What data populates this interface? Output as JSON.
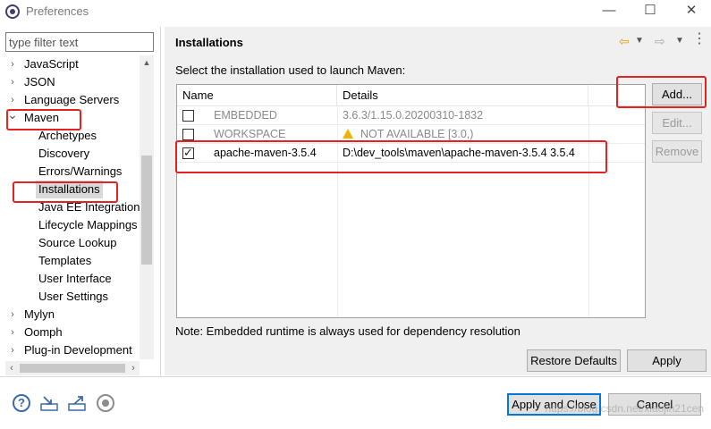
{
  "window": {
    "title": "Preferences",
    "minimize_glyph": "—",
    "maximize_glyph": "☐",
    "close_glyph": "✕"
  },
  "sidebar": {
    "filter_placeholder": "type filter text",
    "items": [
      {
        "label": "JavaScript",
        "expanded": false,
        "level": 0
      },
      {
        "label": "JSON",
        "expanded": false,
        "level": 0
      },
      {
        "label": "Language Servers",
        "expanded": false,
        "level": 0
      },
      {
        "label": "Maven",
        "expanded": true,
        "level": 0
      },
      {
        "label": "Archetypes",
        "level": 1
      },
      {
        "label": "Discovery",
        "level": 1
      },
      {
        "label": "Errors/Warnings",
        "level": 1
      },
      {
        "label": "Installations",
        "level": 1,
        "selected": true
      },
      {
        "label": "Java EE Integration",
        "level": 1
      },
      {
        "label": "Lifecycle Mappings",
        "level": 1
      },
      {
        "label": "Source Lookup",
        "level": 1
      },
      {
        "label": "Templates",
        "level": 1
      },
      {
        "label": "User Interface",
        "level": 1
      },
      {
        "label": "User Settings",
        "level": 1
      },
      {
        "label": "Mylyn",
        "expanded": false,
        "level": 0
      },
      {
        "label": "Oomph",
        "expanded": false,
        "level": 0
      },
      {
        "label": "Plug-in Development",
        "expanded": false,
        "level": 0
      }
    ]
  },
  "page": {
    "title": "Installations",
    "instruction": "Select the installation used to launch Maven:",
    "note": "Note: Embedded runtime is always used for dependency resolution"
  },
  "table": {
    "columns": [
      "Name",
      "Details"
    ],
    "rows": [
      {
        "checked": false,
        "name": "EMBEDDED",
        "details": "3.6.3/1.15.0.20200310-1832",
        "greyed": true,
        "warning": false
      },
      {
        "checked": false,
        "name": "WORKSPACE",
        "details": "NOT AVAILABLE [3.0,)",
        "greyed": true,
        "warning": true
      },
      {
        "checked": true,
        "name": "apache-maven-3.5.4",
        "details": "D:\\dev_tools\\maven\\apache-maven-3.5.4 3.5.4",
        "greyed": false,
        "warning": false
      }
    ]
  },
  "buttons": {
    "add": "Add...",
    "edit": "Edit...",
    "remove": "Remove",
    "restore_defaults": "Restore Defaults",
    "apply": "Apply",
    "apply_and_close": "Apply and Close",
    "cancel": "Cancel"
  },
  "watermark": "https://blog.csdn.net/xiaojin21cen",
  "colors": {
    "annotation_red": "#e32222",
    "default_button_border": "#0078d7",
    "warning_yellow": "#f0b400"
  }
}
